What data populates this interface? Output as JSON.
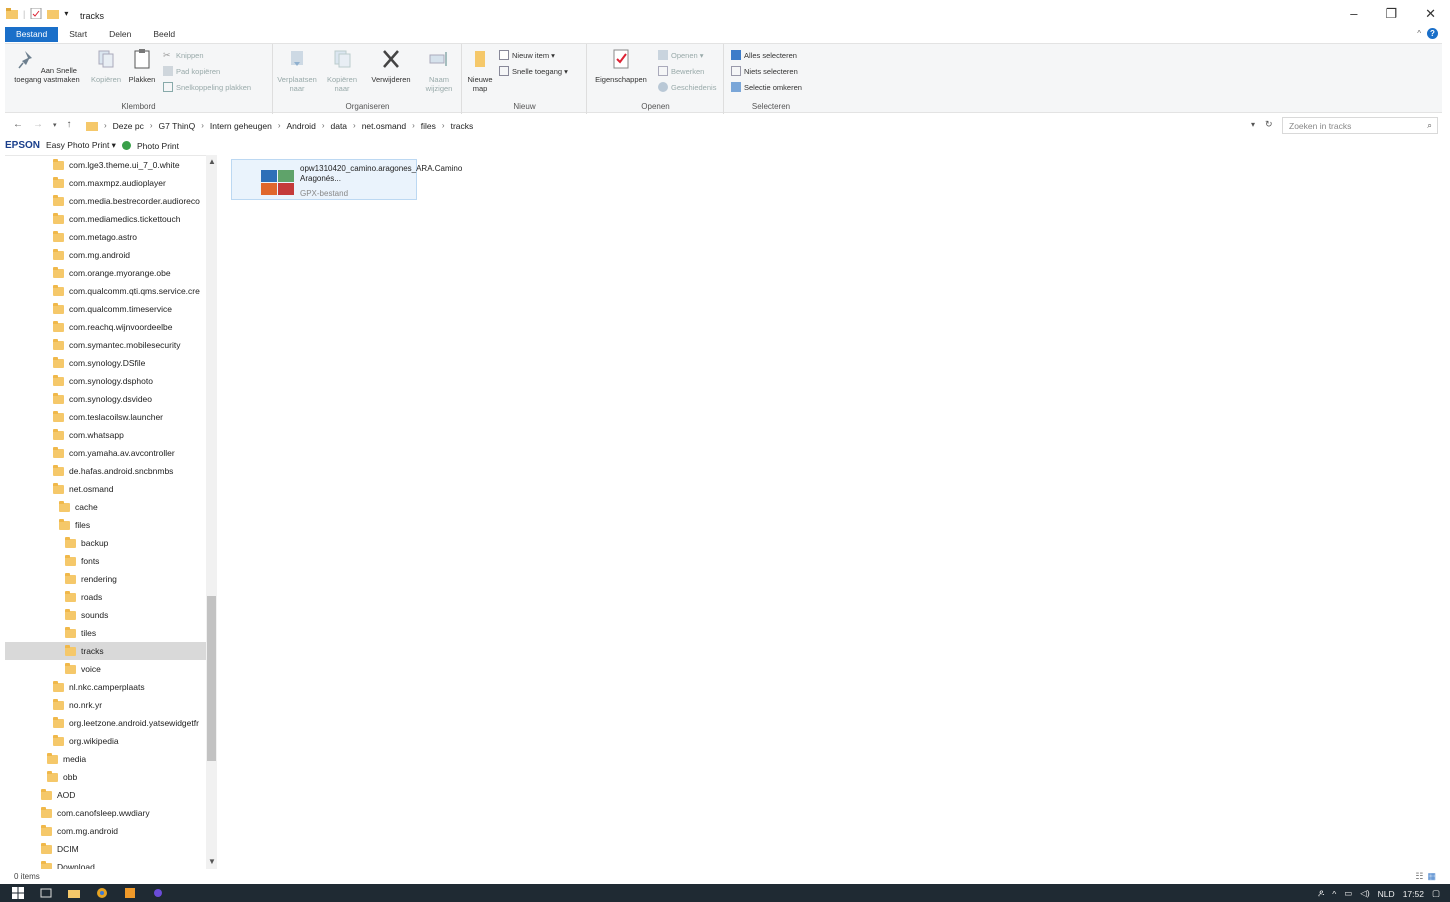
{
  "window": {
    "title": "tracks",
    "controls": {
      "minimize": "–",
      "restore": "❐",
      "close": "✕"
    }
  },
  "tabs": [
    "Bestand",
    "Start",
    "Delen",
    "Beeld"
  ],
  "ribbon": {
    "klembord": {
      "label": "Klembord",
      "pin": "Aan Snelle toegang vastmaken",
      "copy": "Kopiëren",
      "paste": "Plakken",
      "cut": "Knippen",
      "copy_path": "Pad kopiëren",
      "paste_shortcut": "Snelkoppeling plakken"
    },
    "organiseren": {
      "label": "Organiseren",
      "move_to": "Verplaatsen naar",
      "copy_to": "Kopiëren naar",
      "delete": "Verwijderen",
      "rename": "Naam wijzigen"
    },
    "nieuw": {
      "label": "Nieuw",
      "new_folder": "Nieuwe map",
      "new_item": "Nieuw item ▾",
      "easy_access": "Snelle toegang ▾"
    },
    "openen": {
      "label": "Openen",
      "properties": "Eigenschappen",
      "open": "Openen ▾",
      "edit": "Bewerken",
      "history": "Geschiedenis"
    },
    "selecteren": {
      "label": "Selecteren",
      "select_all": "Alles selecteren",
      "select_none": "Niets selecteren",
      "invert": "Selectie omkeren"
    }
  },
  "address": {
    "crumbs": [
      "Deze pc",
      "G7 ThinQ",
      "Intern geheugen",
      "Android",
      "data",
      "net.osmand",
      "files",
      "tracks"
    ],
    "search_placeholder": "Zoeken in tracks"
  },
  "favorites": {
    "epson": "EPSON",
    "easy_photo_print": "Easy Photo Print ▾",
    "photo_print": "Photo Print"
  },
  "tree": [
    {
      "label": "com.lge3.theme.ui_7_0.white",
      "indent": 2
    },
    {
      "label": "com.maxmpz.audioplayer",
      "indent": 2
    },
    {
      "label": "com.media.bestrecorder.audioreco",
      "indent": 2
    },
    {
      "label": "com.mediamedics.tickettouch",
      "indent": 2
    },
    {
      "label": "com.metago.astro",
      "indent": 2
    },
    {
      "label": "com.mg.android",
      "indent": 2
    },
    {
      "label": "com.orange.myorange.obe",
      "indent": 2
    },
    {
      "label": "com.qualcomm.qti.qms.service.cre",
      "indent": 2
    },
    {
      "label": "com.qualcomm.timeservice",
      "indent": 2
    },
    {
      "label": "com.reachq.wijnvoordeelbe",
      "indent": 2
    },
    {
      "label": "com.symantec.mobilesecurity",
      "indent": 2
    },
    {
      "label": "com.synology.DSfile",
      "indent": 2
    },
    {
      "label": "com.synology.dsphoto",
      "indent": 2
    },
    {
      "label": "com.synology.dsvideo",
      "indent": 2
    },
    {
      "label": "com.teslacoilsw.launcher",
      "indent": 2
    },
    {
      "label": "com.whatsapp",
      "indent": 2
    },
    {
      "label": "com.yamaha.av.avcontroller",
      "indent": 2
    },
    {
      "label": "de.hafas.android.sncbnmbs",
      "indent": 2
    },
    {
      "label": "net.osmand",
      "indent": 2
    },
    {
      "label": "cache",
      "indent": 3
    },
    {
      "label": "files",
      "indent": 3
    },
    {
      "label": "backup",
      "indent": 4
    },
    {
      "label": "fonts",
      "indent": 4
    },
    {
      "label": "rendering",
      "indent": 4
    },
    {
      "label": "roads",
      "indent": 4
    },
    {
      "label": "sounds",
      "indent": 4
    },
    {
      "label": "tiles",
      "indent": 4
    },
    {
      "label": "tracks",
      "indent": 4,
      "selected": true
    },
    {
      "label": "voice",
      "indent": 4
    },
    {
      "label": "nl.nkc.camperplaats",
      "indent": 2
    },
    {
      "label": "no.nrk.yr",
      "indent": 2
    },
    {
      "label": "org.leetzone.android.yatsewidgetfr",
      "indent": 2
    },
    {
      "label": "org.wikipedia",
      "indent": 2
    },
    {
      "label": "media",
      "indent": 1
    },
    {
      "label": "obb",
      "indent": 1
    },
    {
      "label": "AOD",
      "indent": 0
    },
    {
      "label": "com.canofsleep.wwdiary",
      "indent": 0
    },
    {
      "label": "com.mg.android",
      "indent": 0
    },
    {
      "label": "DCIM",
      "indent": 0
    },
    {
      "label": "Download",
      "indent": 0
    }
  ],
  "file": {
    "name": "opw1310420_camino.aragones_ARA.Camino Aragonés...",
    "type": "GPX-bestand"
  },
  "status": {
    "items": "0 items"
  },
  "taskbar": {
    "lang": "NLD",
    "time": "17:52"
  },
  "colors": {
    "accent": "#1a6fc9",
    "folder": "#f5c86a",
    "selection": "#d9d9d9"
  }
}
